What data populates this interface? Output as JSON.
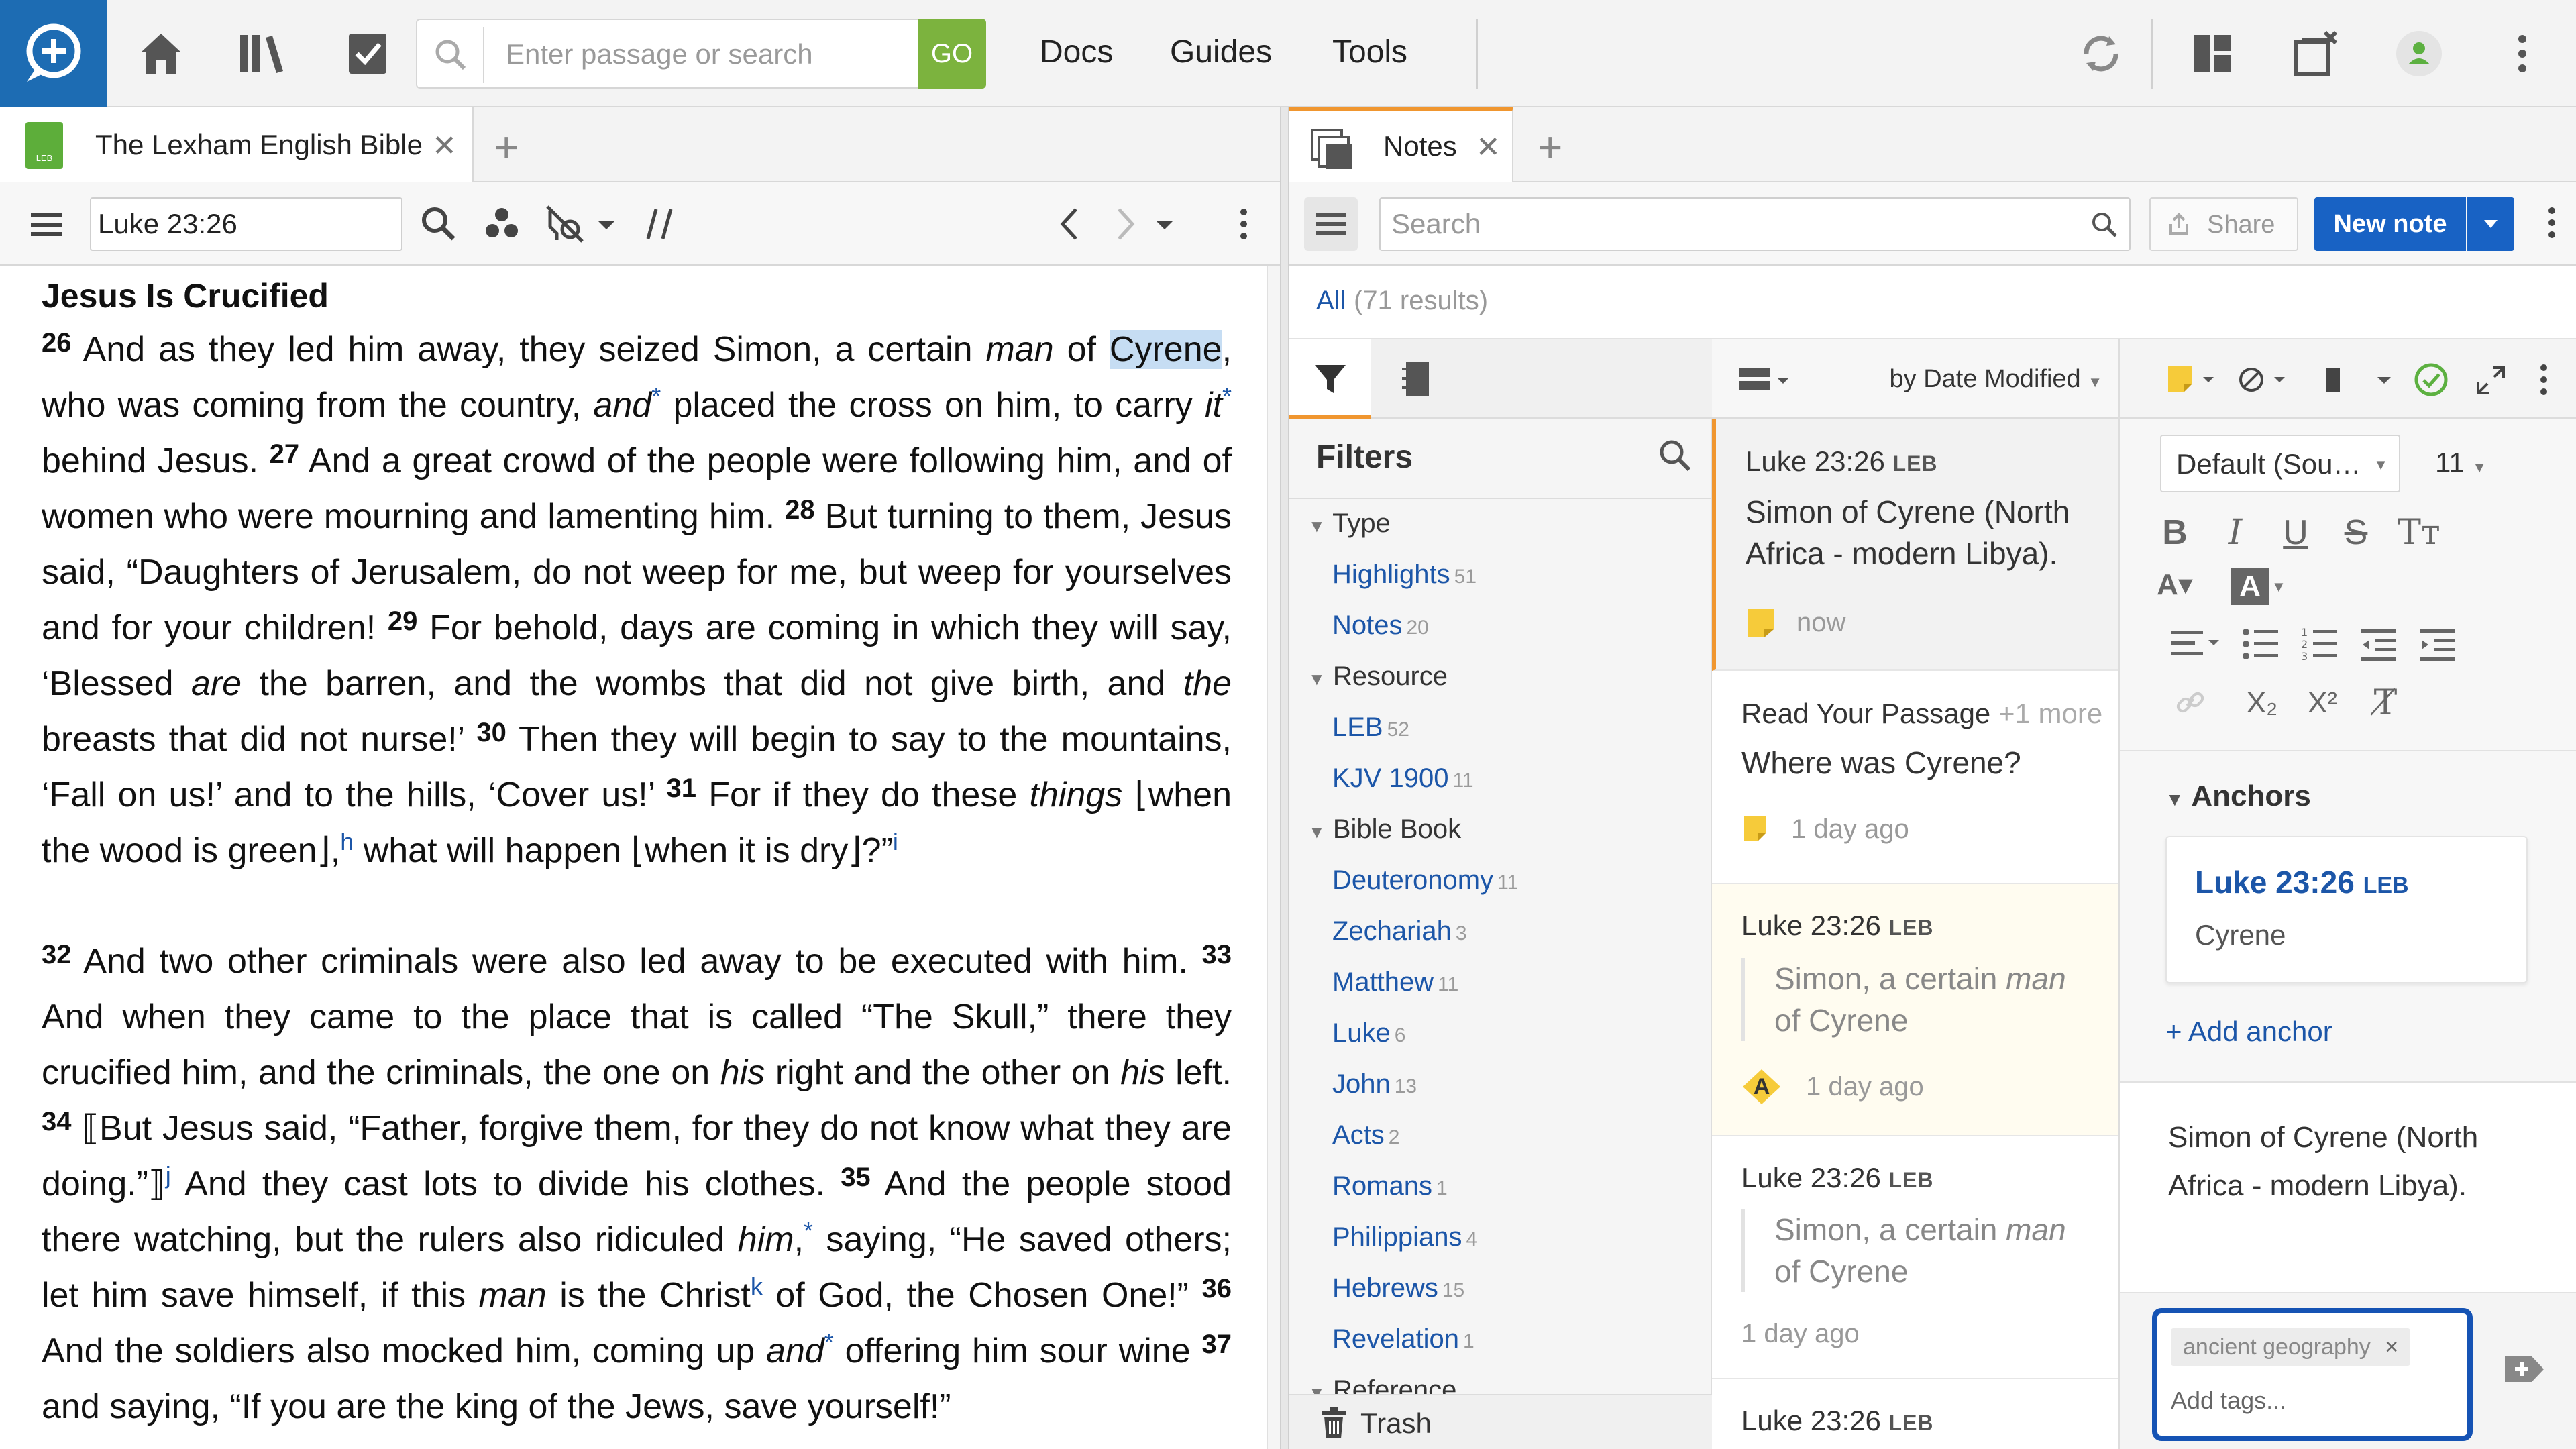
{
  "topbar": {
    "search_placeholder": "Enter passage or search",
    "go_label": "GO",
    "menu": [
      "Docs",
      "Guides",
      "Tools"
    ]
  },
  "left_panel": {
    "tab_title": "The Lexham English Bible",
    "tab_badge": "LEB",
    "reference": "Luke 23:26",
    "heading": "Jesus Is Crucified"
  },
  "right_panel": {
    "tab_title": "Notes",
    "search_placeholder": "Search",
    "share_label": "Share",
    "new_note_label": "New note",
    "results_all": "All",
    "results_count": "(71 results)",
    "filters": {
      "header": "Filters",
      "groups": [
        {
          "label": "Type",
          "items": [
            {
              "label": "Highlights",
              "count": "51"
            },
            {
              "label": "Notes",
              "count": "20"
            }
          ]
        },
        {
          "label": "Resource",
          "items": [
            {
              "label": "LEB",
              "count": "52"
            },
            {
              "label": "KJV 1900",
              "count": "11"
            }
          ]
        },
        {
          "label": "Bible Book",
          "items": [
            {
              "label": "Deuteronomy",
              "count": "11"
            },
            {
              "label": "Zechariah",
              "count": "3"
            },
            {
              "label": "Matthew",
              "count": "11"
            },
            {
              "label": "Luke",
              "count": "6"
            },
            {
              "label": "John",
              "count": "13"
            },
            {
              "label": "Acts",
              "count": "2"
            },
            {
              "label": "Romans",
              "count": "1"
            },
            {
              "label": "Philippians",
              "count": "4"
            },
            {
              "label": "Hebrews",
              "count": "15"
            },
            {
              "label": "Revelation",
              "count": "1"
            }
          ]
        },
        {
          "label": "Reference"
        }
      ],
      "trash_label": "Trash"
    },
    "sort_label": "by Date Modified",
    "notes": [
      {
        "ref": "Luke 23:26",
        "resource": "LEB",
        "body": "Simon of Cyrene (North Africa - modern Libya).",
        "time": "now"
      },
      {
        "ref": "Read Your Passage",
        "more": "+1 more",
        "body": "Where was Cyrene?",
        "time": "1 day ago"
      },
      {
        "ref": "Luke 23:26",
        "resource": "LEB",
        "quote_plain1": "Simon, a certain ",
        "quote_italic": "man",
        "quote_plain2": "of Cyrene",
        "time": "1 day ago",
        "badge": "A"
      },
      {
        "ref": "Luke 23:26",
        "resource": "LEB",
        "quote_plain1": "Simon, a certain ",
        "quote_italic": "man",
        "quote_plain2": "of Cyrene",
        "time": "1 day ago"
      },
      {
        "ref": "Luke 23:26",
        "resource": "LEB"
      }
    ],
    "editor": {
      "font": "Default (Sou…",
      "size": "11",
      "anchors_title": "Anchors",
      "anchor_ref": "Luke 23:26",
      "anchor_resource": "LEB",
      "anchor_text": "Cyrene",
      "add_anchor": "+ Add anchor",
      "content": "Simon of Cyrene (North Africa - modern Libya).",
      "tag": "ancient geography",
      "tag_remove": "×",
      "tags_placeholder": "Add tags..."
    }
  },
  "colors": {
    "accent_blue": "#1862c4",
    "go_green": "#7cb33e",
    "logo_blue": "#1d6cb3",
    "highlight": "#c6ddf3",
    "note_yellow": "#f6cb3a",
    "active_tab": "#f0962f",
    "tags_focus": "#1553b4"
  }
}
